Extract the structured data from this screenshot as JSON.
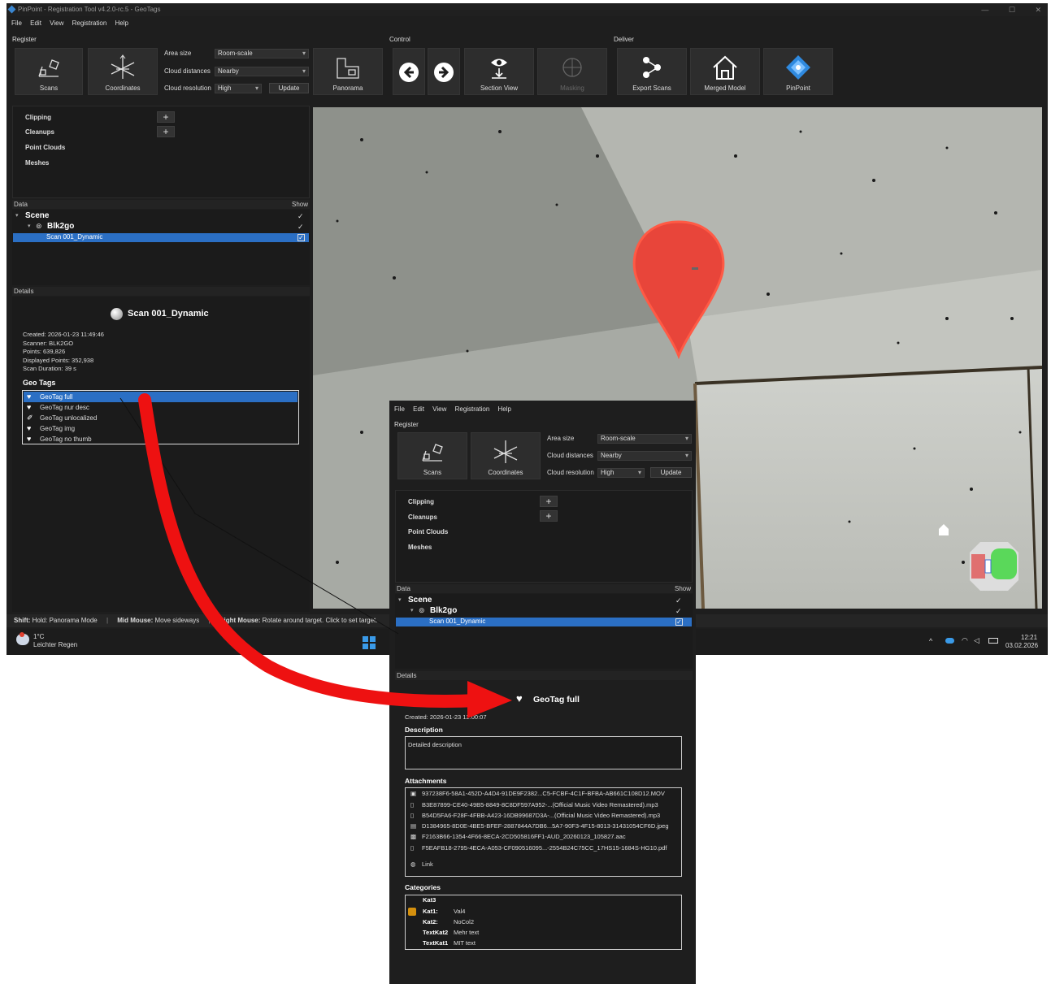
{
  "window": {
    "title": "PinPoint - Registration Tool v4.2.0-rc.5 - GeoTags",
    "controls": [
      "—",
      "☐",
      "✕"
    ]
  },
  "menu": [
    "File",
    "Edit",
    "View",
    "Registration",
    "Help"
  ],
  "ribbon": {
    "register_label": "Register",
    "control_label": "Control",
    "deliver_label": "Deliver",
    "scans": "Scans",
    "coordinates": "Coordinates",
    "area_size_label": "Area size",
    "area_size_value": "Room-scale",
    "cloud_distances_label": "Cloud distances",
    "cloud_distances_value": "Nearby",
    "cloud_resolution_label": "Cloud resolution",
    "cloud_resolution_value": "High",
    "update": "Update",
    "panorama": "Panorama",
    "section_view": "Section View",
    "masking": "Masking",
    "export_scans": "Export Scans",
    "merged_model": "Merged Model",
    "pinpoint": "PinPoint"
  },
  "tools": {
    "clipping": "Clipping",
    "cleanups": "Cleanups",
    "point_clouds": "Point Clouds",
    "meshes": "Meshes",
    "plus": "+"
  },
  "data_panel": {
    "title": "Data",
    "show": "Show",
    "scene": "Scene",
    "blk2go": "Blk2go",
    "scan": "Scan 001_Dynamic",
    "tick": "✓",
    "check": "✓"
  },
  "details": {
    "title": "Details",
    "scan_name": "Scan 001_Dynamic",
    "info": [
      "Created: 2026-01-23 11:49:46",
      "Scanner: BLK2GO",
      "Points: 639,826",
      "Displayed Points: 352,938",
      "Scan Duration: 39 s"
    ],
    "geo_tags_title": "Geo Tags",
    "geo_tags": [
      "GeoTag full",
      "GeoTag nur desc",
      "GeoTag unlocalized",
      "GeoTag img",
      "GeoTag no thumb"
    ]
  },
  "status": {
    "shift_key": "Shift:",
    "shift_text": "Hold: Panorama Mode",
    "mid_key": "Mid Mouse:",
    "mid_text": "Move sideways",
    "right_key": "Right Mouse:",
    "right_text": "Rotate around target. Click to set target."
  },
  "taskbar": {
    "temp": "1°C",
    "weather": "Leichter Regen",
    "time": "12:21",
    "date": "03.02.2026"
  },
  "detail_popup": {
    "geotag_name": "GeoTag full",
    "created": "Created: 2026-01-23 12:00:07",
    "description_title": "Description",
    "description": "Detailed description",
    "attachments_title": "Attachments",
    "attachments": [
      "937238F6-58A1-452D-A4D4-91DE9F2382...C5-FCBF-4C1F-BFBA-AB661C108D12.MOV",
      "B3E87899-CE40-49B5-8849-8C8DF597A952-...(Official Music Video Remastered).mp3",
      "B54D5FA6-F28F-4FBB-A423-16DB99687D3A-...(Official Music Video Remastered).mp3",
      "D1384965-8D0E-4BE5-BFEF-2887844A7DB6...5A7-90F3-4F15-8013-31431054CF6D.jpeg",
      "F2163B66-1354-4F66-8ECA-2CD505816FF1-AUD_20260123_105827.aac",
      "F5EAFB18-2795-4ECA-A053-CF090516095...-2554B24C75CC_17HS15-1684S-HG10.pdf",
      "Link"
    ],
    "categories_title": "Categories",
    "categories": [
      {
        "key": "Kat3",
        "value": ""
      },
      {
        "key": "Kat1:",
        "value": "Val4"
      },
      {
        "key": "Kat2:",
        "value": "NoCol2"
      },
      {
        "key": "TextKat2",
        "value": "Mehr text"
      },
      {
        "key": "TextKat1",
        "value": "MIT text"
      }
    ]
  },
  "colors": {
    "accent": "#2b6fc4",
    "pin": "#e8453a",
    "arrow": "#ee1111",
    "category_swatch": "#d4900e"
  }
}
